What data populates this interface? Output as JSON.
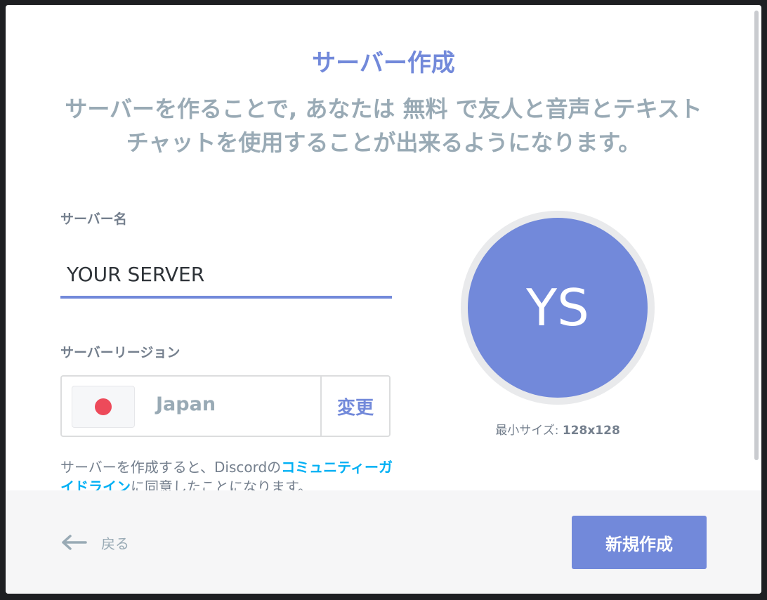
{
  "modal": {
    "title": "サーバー作成",
    "subtitle": "サーバーを作ることで, あなたは 無料 で友人と音声とテキストチャットを使用することが出来るようになります。"
  },
  "form": {
    "server_name_label": "サーバー名",
    "server_name_value": "YOUR SERVER",
    "region_label": "サーバーリージョン",
    "region_value": "Japan",
    "region_change_label": "変更",
    "region_flag_icon": "japan-flag-icon"
  },
  "guidelines": {
    "text_before": "サーバーを作成すると、Discordの",
    "link_text": "コミュニティーガイドライン",
    "text_after": "に同意したことになります。"
  },
  "avatar": {
    "initials": "YS",
    "min_size_label": "最小サイズ:",
    "min_size_value": "128x128",
    "color": "#7289da"
  },
  "footer": {
    "back_label": "戻る",
    "back_icon": "arrow-left-icon",
    "create_label": "新規作成"
  },
  "colors": {
    "accent": "#7289da",
    "link": "#00b0f4",
    "muted": "#99aab5"
  }
}
